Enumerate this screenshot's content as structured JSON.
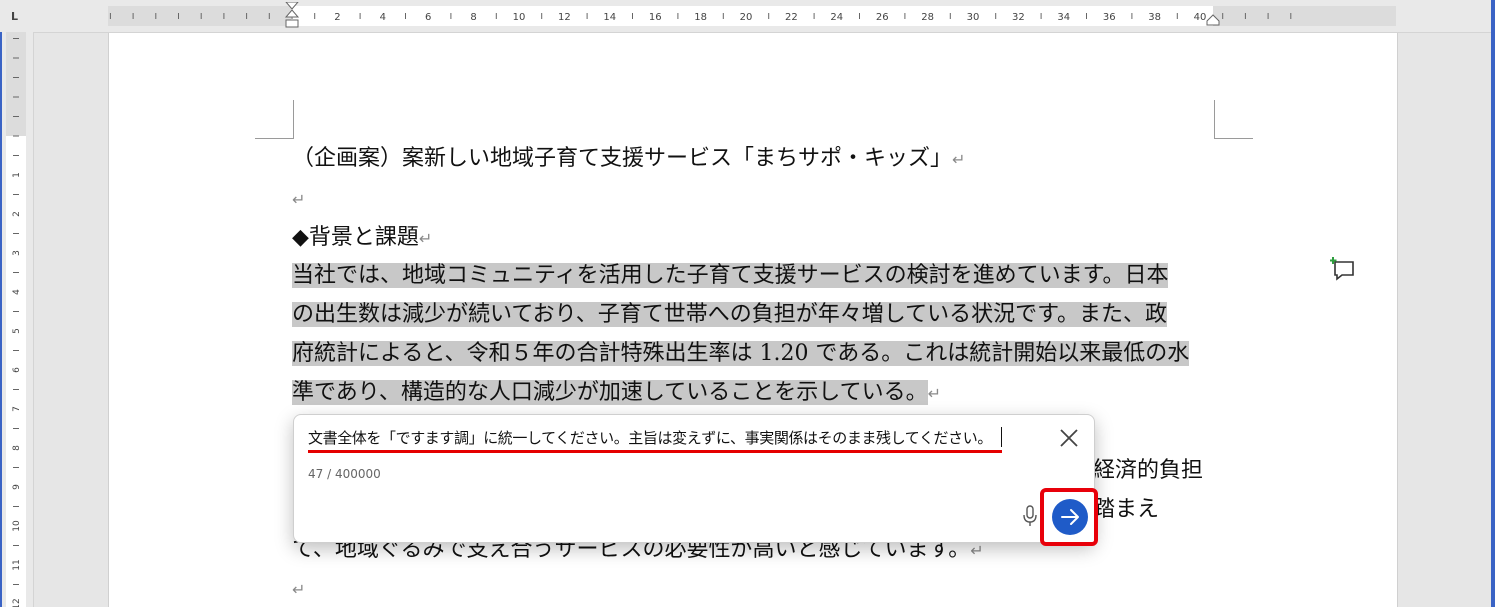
{
  "ruler": {
    "h_labels": [
      "2",
      "4",
      "6",
      "8",
      "10",
      "12",
      "14",
      "16",
      "18",
      "20",
      "22",
      "24",
      "26",
      "28",
      "30",
      "32",
      "34",
      "36",
      "38",
      "40"
    ],
    "v_labels": [
      "1",
      "2",
      "3",
      "4",
      "5",
      "6",
      "7",
      "8",
      "9",
      "10",
      "11",
      "12"
    ]
  },
  "document": {
    "title_line": "（企画案）案新しい地域子育て支援サービス「まちサポ・キッズ」",
    "blank_1": "",
    "heading": "◆背景と課題",
    "para1_line1": "当社では、地域コミュニティを活用した子育て支援サービスの検討を進めています。日本",
    "para1_line2": "の出生数は減少が続いており、子育て世帯への負担が年々増している状況です。また、政",
    "para1_line3": "府統計によると、令和５年の合計特殊出生率は 1.20 である。これは統計開始以来最低の水",
    "para1_line4": "準であり、構造的な人口減少が加速していることを示している。",
    "para2_frag1": "経済的負担",
    "para2_frag2": "踏まえ",
    "para2_line3": "て、地域ぐるみで支え合うサービスの必要性が高いと感じています。",
    "return_mark": "↵"
  },
  "prompt_box": {
    "input_value": "文書全体を「ですます調」に統一してください。主旨は変えずに、事実関係はそのまま残してください。",
    "char_counter": "47 / 400000",
    "close_icon": "close-icon",
    "mic_icon": "microphone-icon",
    "submit_icon": "arrow-right-icon"
  },
  "colors": {
    "selection": "#c8c8c8",
    "highlight_red": "#e50000",
    "submit_blue": "#1f5bc8",
    "ruler_blue": "#3a63c5",
    "comment_plus_green": "#2e9e3e"
  }
}
